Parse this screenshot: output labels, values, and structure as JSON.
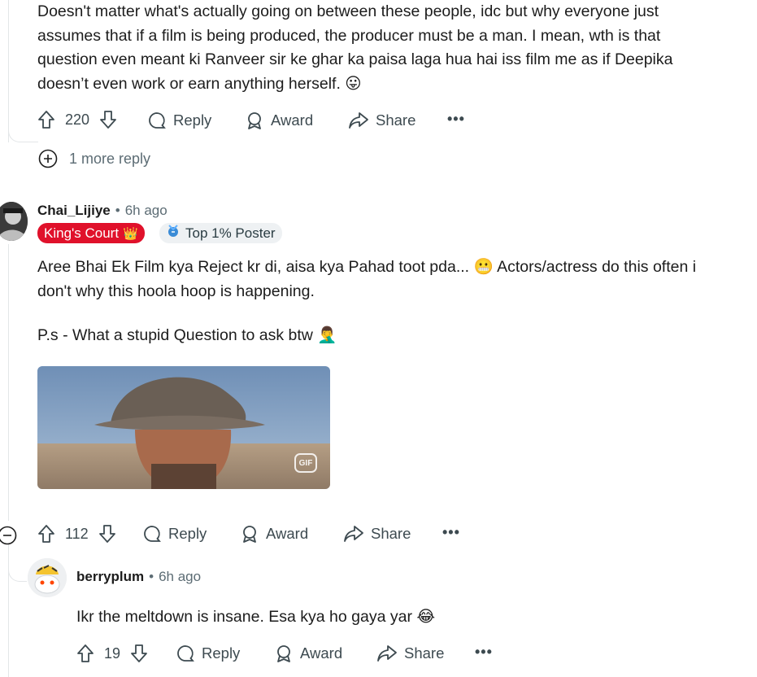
{
  "comment1": {
    "text_lines": [
      "Doesn't matter what's actually going on between these people, idc but why everyone just",
      "assumes that if a film is being produced, the producer must be a man. I mean, wth is that",
      "question even meant ki Ranveer sir ke ghar ka paisa laga hua hai iss film me as if Deepika",
      "doesn’t even work or earn anything herself. 😛"
    ],
    "votes": "220",
    "reply_label": "Reply",
    "award_label": "Award",
    "share_label": "Share",
    "more_replies": "1 more reply"
  },
  "comment2": {
    "username": "Chai_Lijiye",
    "separator": "•",
    "time": "6h ago",
    "flair_text": "King's Court",
    "flair_emoji": "👑",
    "flair_color": "#e0112b",
    "badge_text": "Top 1% Poster",
    "paragraph1_line1": "Aree Bhai Ek Film kya Reject kr di, aisa kya Pahad toot pda... 😬  Actors/actress do this often i",
    "paragraph1_line2": "don't why this hoola hoop is happening.",
    "paragraph2": "P.s - What a stupid Question to ask btw 🤦‍♂️",
    "gif_label": "GIF",
    "votes": "112",
    "reply_label": "Reply",
    "award_label": "Award",
    "share_label": "Share"
  },
  "comment3": {
    "username": "berryplum",
    "separator": "•",
    "time": "6h ago",
    "text": "Ikr the meltdown is insane. Esa kya ho gaya yar 😂",
    "votes": "19",
    "reply_label": "Reply",
    "award_label": "Award",
    "share_label": "Share"
  }
}
